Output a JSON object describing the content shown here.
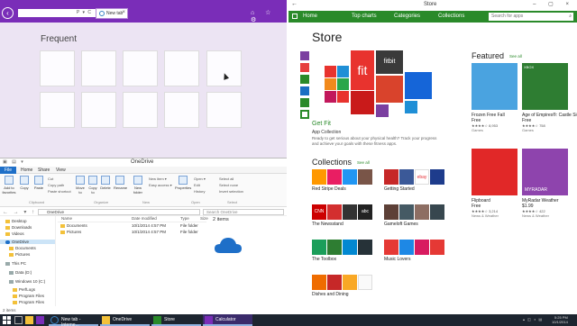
{
  "ie": {
    "tab_label": "New tab",
    "frequent_heading": "Frequent",
    "addr_icons": "P ▾ C",
    "right_icons": "⌂ ☆ ⚙"
  },
  "explorer": {
    "title": "OneDrive",
    "tabs": [
      "File",
      "Home",
      "Share",
      "View"
    ],
    "ribbon": {
      "add_favorites": "Add to favorites",
      "copy": "Copy",
      "paste": "Paste",
      "cut": "Cut",
      "copy_path": "Copy path",
      "paste_shortcut": "Paste shortcut",
      "move_to": "Move to",
      "copy_to": "Copy to",
      "delete": "Delete",
      "rename": "Rename",
      "new_folder": "New folder",
      "new_item": "New item ▾",
      "easy_access": "Easy access ▾",
      "properties": "Properties",
      "open": "Open ▾",
      "edit": "Edit",
      "history": "History",
      "select_all": "Select all",
      "select_none": "Select none",
      "invert_selection": "Invert selection",
      "groups": [
        "Clipboard",
        "Organize",
        "New",
        "Open",
        "Select"
      ]
    },
    "path": "OneDrive",
    "search_placeholder": "Search OneDrive",
    "tree": [
      "Desktop",
      "Downloads",
      "Videos",
      "OneDrive",
      "Documents",
      "Pictures",
      "This PC",
      "Data (D:)",
      "Windows 10 (C:)",
      "PerfLogs",
      "Program Files",
      "Program Files"
    ],
    "columns": [
      "Name",
      "Date modified",
      "Type",
      "Size"
    ],
    "rows": [
      {
        "name": "Documents",
        "date": "10/1/2014 4:57 PM",
        "type": "File folder"
      },
      {
        "name": "Pictures",
        "date": "10/1/2014 4:57 PM",
        "type": "File folder"
      }
    ],
    "preview_count": "2 items",
    "status": "2 items"
  },
  "store": {
    "title": "Store",
    "nav": [
      "Home",
      "Top charts",
      "Categories",
      "Collections"
    ],
    "search_placeholder": "Search for apps",
    "heading": "Store",
    "hero_words": {
      "fit": "fit",
      "fitbit": "fitbit"
    },
    "getfit_title": "Get Fit",
    "getfit_sub": "App Collection",
    "getfit_desc": "Ready to get serious about your physical health? Track your progress and achieve your goals with these fitness apps.",
    "collections_heading": "Collections",
    "see_all": "See all",
    "collections": [
      "Red Stripe Deals",
      "Getting Started",
      "The Newsstand",
      "Gameloft Games",
      "The Toolbox",
      "Music Lovers",
      "Dishes and Dining"
    ],
    "collection_tile_text": {
      "ebay": "ebay",
      "abc": "abc",
      "cnn": "CNN"
    },
    "featured_heading": "Featured",
    "apps": [
      {
        "name": "Frozen Free Fall",
        "price": "Free",
        "rating": "★★★★☆",
        "count": "8,953",
        "category": "Games"
      },
      {
        "name": "Age of Empires®: Castle Siege",
        "price": "Free",
        "rating": "★★★★☆",
        "count": "758",
        "category": "Games"
      },
      {
        "name": "Flipboard",
        "price": "Free",
        "rating": "★★★★☆",
        "count": "3,214",
        "category": "News & Weather"
      },
      {
        "name": "MyRadar Weather",
        "price": "$1.99",
        "rating": "★★★★☆",
        "count": "422",
        "category": "News & Weather"
      }
    ],
    "app_tile_text": {
      "xbox": "XBOX",
      "myradar": "MYRADAR"
    }
  },
  "taskbar": {
    "items": [
      "New tab - Interne...",
      "OneDrive",
      "Store",
      "Calculator"
    ],
    "clock_time": "5:25 PM",
    "clock_date": "10/1/2014"
  },
  "colors": {
    "ie_accent": "#7a2db8",
    "store_accent": "#2a8a2a",
    "explorer_accent": "#1e6fc8"
  }
}
